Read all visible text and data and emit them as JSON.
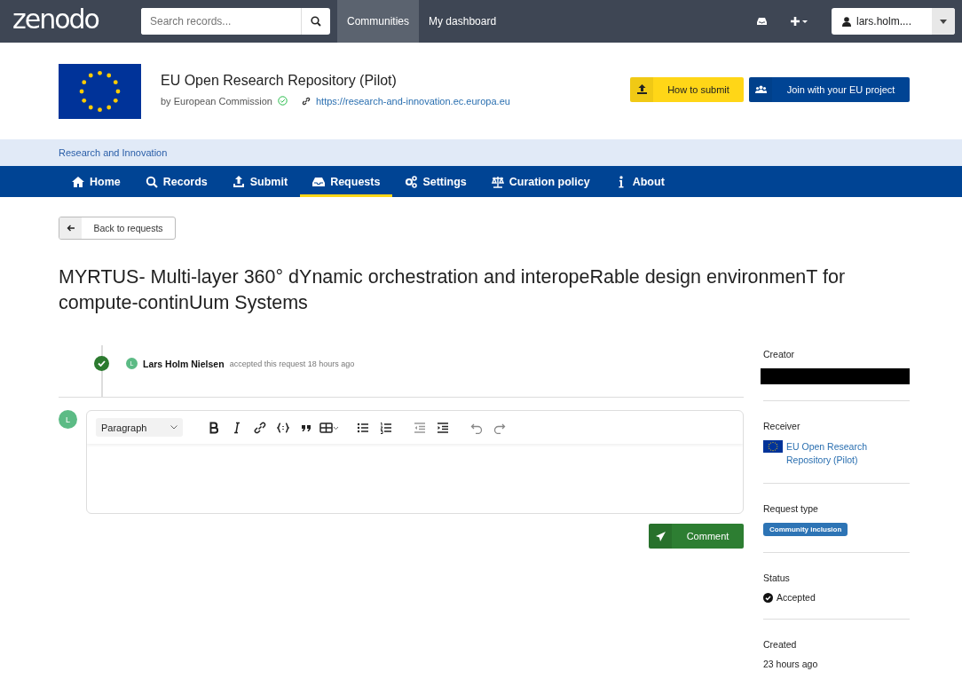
{
  "topbar": {
    "logo": "zenodo",
    "search": {
      "placeholder": "Search records..."
    },
    "links": [
      {
        "label": "Communities",
        "selected": true
      },
      {
        "label": "My dashboard",
        "selected": false
      }
    ],
    "user": "lars.holm...."
  },
  "community": {
    "title": "EU Open Research Repository (Pilot)",
    "owner": "by European Commission",
    "verified": true,
    "url": "https://research-and-innovation.ec.europa.eu",
    "buttons": [
      {
        "label": "How to submit",
        "kind": "primary"
      },
      {
        "label": "Join with your EU project",
        "kind": "secondary"
      }
    ]
  },
  "breadcrumb": "Research and Innovation",
  "tabs": [
    {
      "label": "Home",
      "selected": false
    },
    {
      "label": "Records",
      "selected": false
    },
    {
      "label": "Submit",
      "selected": false
    },
    {
      "label": "Requests",
      "selected": true
    },
    {
      "label": "Settings",
      "selected": false
    },
    {
      "label": "Curation policy",
      "selected": false
    },
    {
      "label": "About",
      "selected": false
    }
  ],
  "back_button": "Back to requests",
  "request_title": "MYRTUS- Multi-layer 360° dYnamic orchestration and interopeRable design environmenT for compute-continUum Systems",
  "timeline": [
    {
      "avatar": "L",
      "author": "Lars Holm Nielsen",
      "action": "accepted this request 18 hours ago"
    }
  ],
  "editor": {
    "avatar": "L",
    "block_format": "Paragraph"
  },
  "comment_button": "Comment",
  "sidebar": [
    {
      "kind": "redacted",
      "label": "Creator"
    },
    {
      "kind": "community",
      "label": "Receiver",
      "value": "EU Open Research Repository (Pilot)"
    },
    {
      "kind": "badge",
      "label": "Request type",
      "value": "Community inclusion"
    },
    {
      "kind": "status",
      "label": "Status",
      "value": "Accepted"
    },
    {
      "kind": "text",
      "label": "Created",
      "value": "23 hours ago"
    }
  ]
}
